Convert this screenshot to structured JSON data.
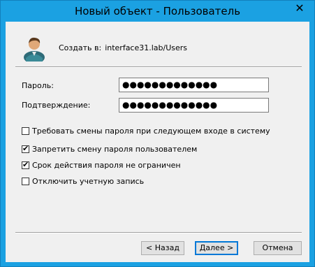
{
  "window": {
    "title": "Новый объект - Пользователь",
    "close_glyph": "✕"
  },
  "header": {
    "create_in_label": "Создать в:",
    "create_in_path": "interface31.lab/Users",
    "avatar_icon": "user-icon"
  },
  "form": {
    "password_label": "Пароль:",
    "password_value": "●●●●●●●●●●●●●",
    "confirm_label": "Подтверждение:",
    "confirm_value": "●●●●●●●●●●●●●"
  },
  "options": [
    {
      "label": "Требовать смены пароля при следующем входе в систему",
      "checked": false
    },
    {
      "label": "Запретить смену пароля пользователем",
      "checked": true
    },
    {
      "label": "Срок действия пароля не ограничен",
      "checked": true
    },
    {
      "label": "Отключить учетную запись",
      "checked": false
    }
  ],
  "buttons": {
    "back_label": "< Назад",
    "next_label": "Далее >",
    "cancel_label": "Отмена"
  },
  "colors": {
    "titlebar": "#1ba1e2",
    "client_bg": "#f0f0f0"
  }
}
